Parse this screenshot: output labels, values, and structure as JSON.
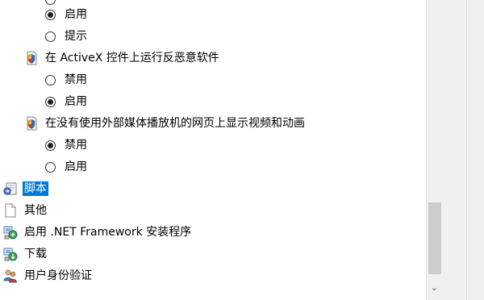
{
  "items": {
    "option_enable_1": "启用",
    "option_prompt": "提示",
    "setting_activex_antimalware": "在 ActiveX 控件上运行反恶意软件",
    "option_disable_2": "禁用",
    "option_enable_2": "启用",
    "setting_media_player": "在没有使用外部媒体播放机的网页上显示视频和动画",
    "option_disable_3": "禁用",
    "option_enable_3": "启用",
    "category_scripting": "脚本",
    "category_misc": "其他",
    "category_dotnet": "启用 .NET Framework 安装程序",
    "category_downloads": "下载",
    "category_user_auth": "用户身份验证"
  },
  "icons": {
    "setting": "security-shield-icon",
    "scripting": "script-icon",
    "misc": "blank-page-icon",
    "dotnet": "network-install-icon",
    "downloads": "download-icon",
    "user_auth": "users-icon"
  },
  "colors": {
    "selection": "#0078d7",
    "scroll_thumb": "#cdcdcd"
  }
}
